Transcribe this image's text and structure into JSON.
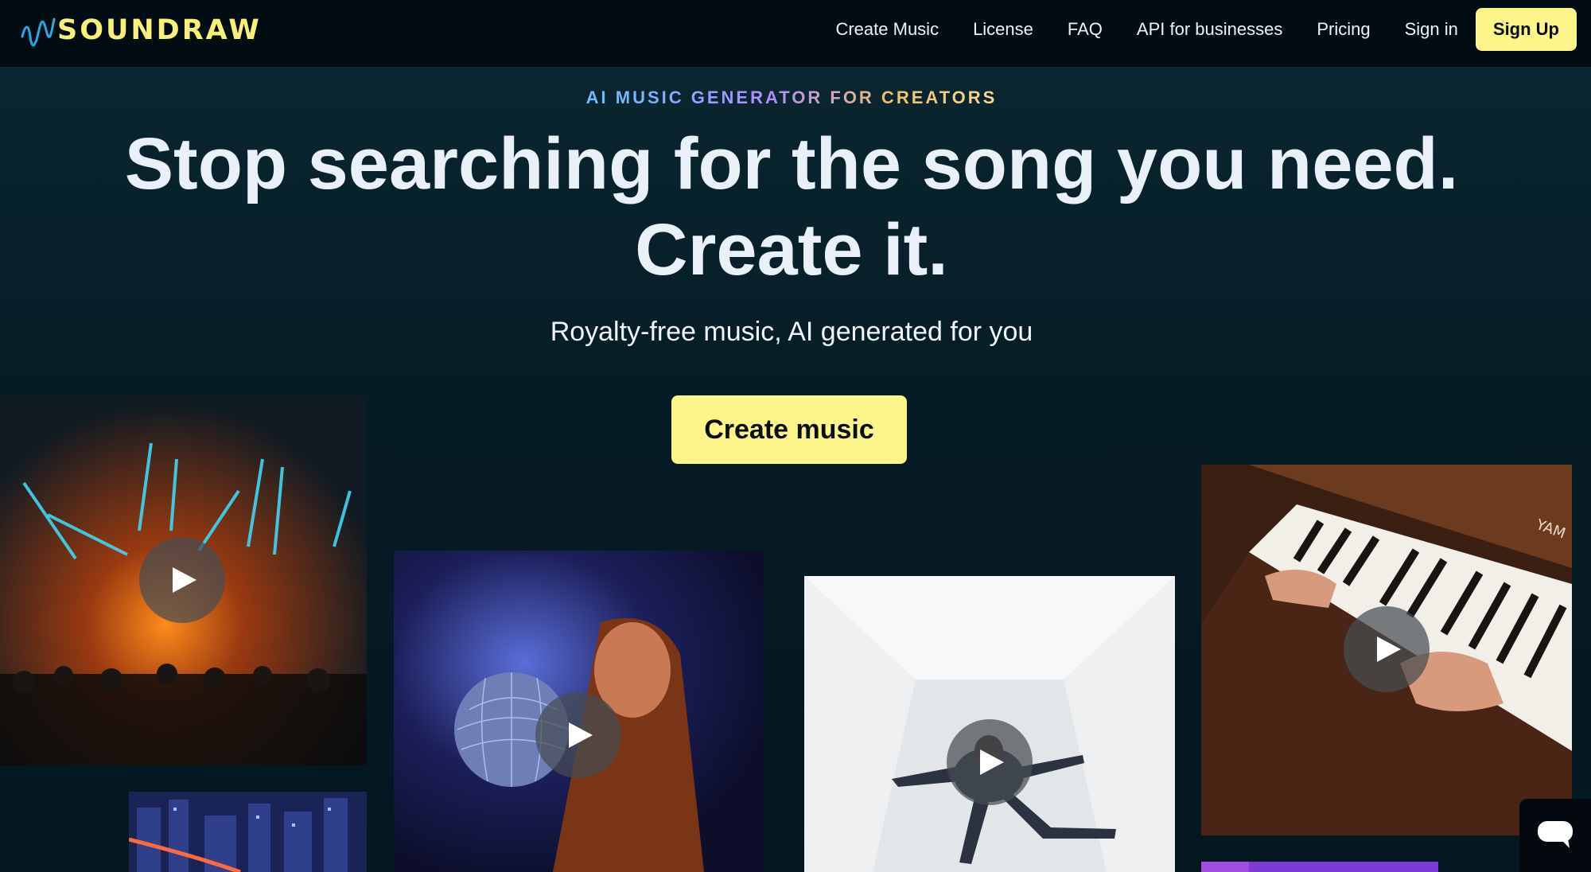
{
  "brand": {
    "name": "SOUNDRAW",
    "accent": "#fbf58a",
    "logo_wave_color": "#2aa8e0"
  },
  "nav": {
    "links": [
      "Create Music",
      "License",
      "FAQ",
      "API for businesses",
      "Pricing",
      "Sign in"
    ],
    "signup_label": "Sign Up"
  },
  "hero": {
    "eyebrow": "AI MUSIC GENERATOR FOR CREATORS",
    "headline_line1": "Stop searching for the song you need.",
    "headline_line2": "Create it.",
    "subheadline": "Royalty-free music, AI generated for you",
    "cta_label": "Create music"
  },
  "tiles": [
    {
      "subject": "concert-lasers",
      "icon": "play-icon"
    },
    {
      "subject": "woman-disco-ball",
      "icon": "play-icon"
    },
    {
      "subject": "dancer-white-room",
      "icon": "play-icon"
    },
    {
      "subject": "hands-on-piano",
      "icon": "play-icon"
    },
    {
      "subject": "night-city",
      "icon": null
    },
    {
      "subject": "purple-scene",
      "icon": null
    }
  ],
  "chat": {
    "icon": "chat-bubble-icon"
  }
}
